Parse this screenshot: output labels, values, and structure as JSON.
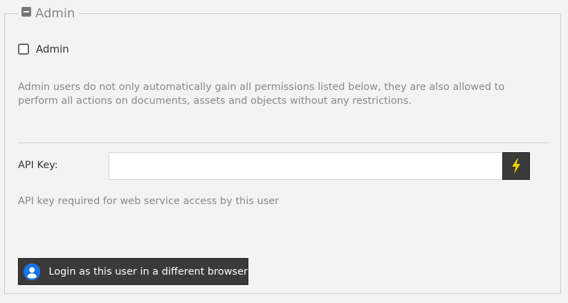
{
  "panel": {
    "title": "Admin",
    "collapse_icon": "collapse-minus-icon"
  },
  "admin": {
    "checkbox_label": "Admin",
    "checked": false,
    "description": "Admin users do not only automatically gain all permissions listed below, they are also allowed to perform all actions on documents, assets and objects without any restrictions."
  },
  "api": {
    "label": "API Key:",
    "value": "",
    "placeholder": "",
    "generate_icon": "lightning-icon",
    "generate_icon_color": "#f5d300",
    "hint": "API key required for web service access by this user"
  },
  "login_button": {
    "label": "Login as this user in a different browser",
    "icon": "user-avatar-icon",
    "icon_color": "#1a73e8"
  }
}
